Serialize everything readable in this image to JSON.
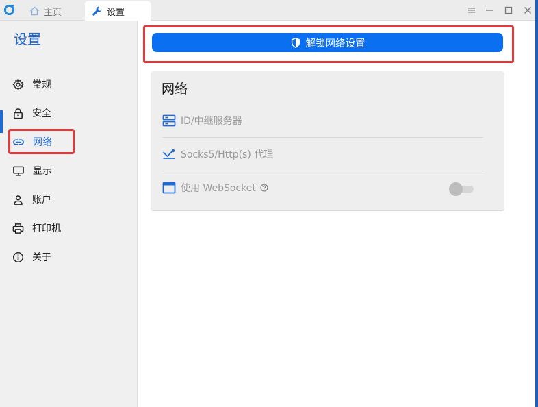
{
  "titlebar": {
    "tabs": [
      {
        "label": "主页",
        "icon": "home-icon"
      },
      {
        "label": "设置",
        "icon": "wrench-icon"
      }
    ],
    "controls": [
      "menu-icon",
      "minimize-icon",
      "maximize-icon",
      "close-icon"
    ]
  },
  "sidebar": {
    "title": "设置",
    "items": [
      {
        "label": "常规",
        "icon": "gear-icon"
      },
      {
        "label": "安全",
        "icon": "lock-icon"
      },
      {
        "label": "网络",
        "icon": "link-icon"
      },
      {
        "label": "显示",
        "icon": "monitor-icon"
      },
      {
        "label": "账户",
        "icon": "user-icon"
      },
      {
        "label": "打印机",
        "icon": "printer-icon"
      },
      {
        "label": "关于",
        "icon": "info-icon"
      }
    ],
    "active_item": "网络"
  },
  "main": {
    "unlock_button_label": "解锁网络设置",
    "network_card": {
      "title": "网络",
      "rows": [
        {
          "label": "ID/中继服务器",
          "icon": "server-icon"
        },
        {
          "label": "Socks5/Http(s) 代理",
          "icon": "proxy-icon"
        },
        {
          "label": "使用 WebSocket",
          "icon": "window-icon"
        }
      ],
      "websocket_enabled": false
    }
  },
  "colors": {
    "accent": "#1e6bd6",
    "button": "#0b6ff2",
    "highlight_box": "#e23a3a"
  }
}
